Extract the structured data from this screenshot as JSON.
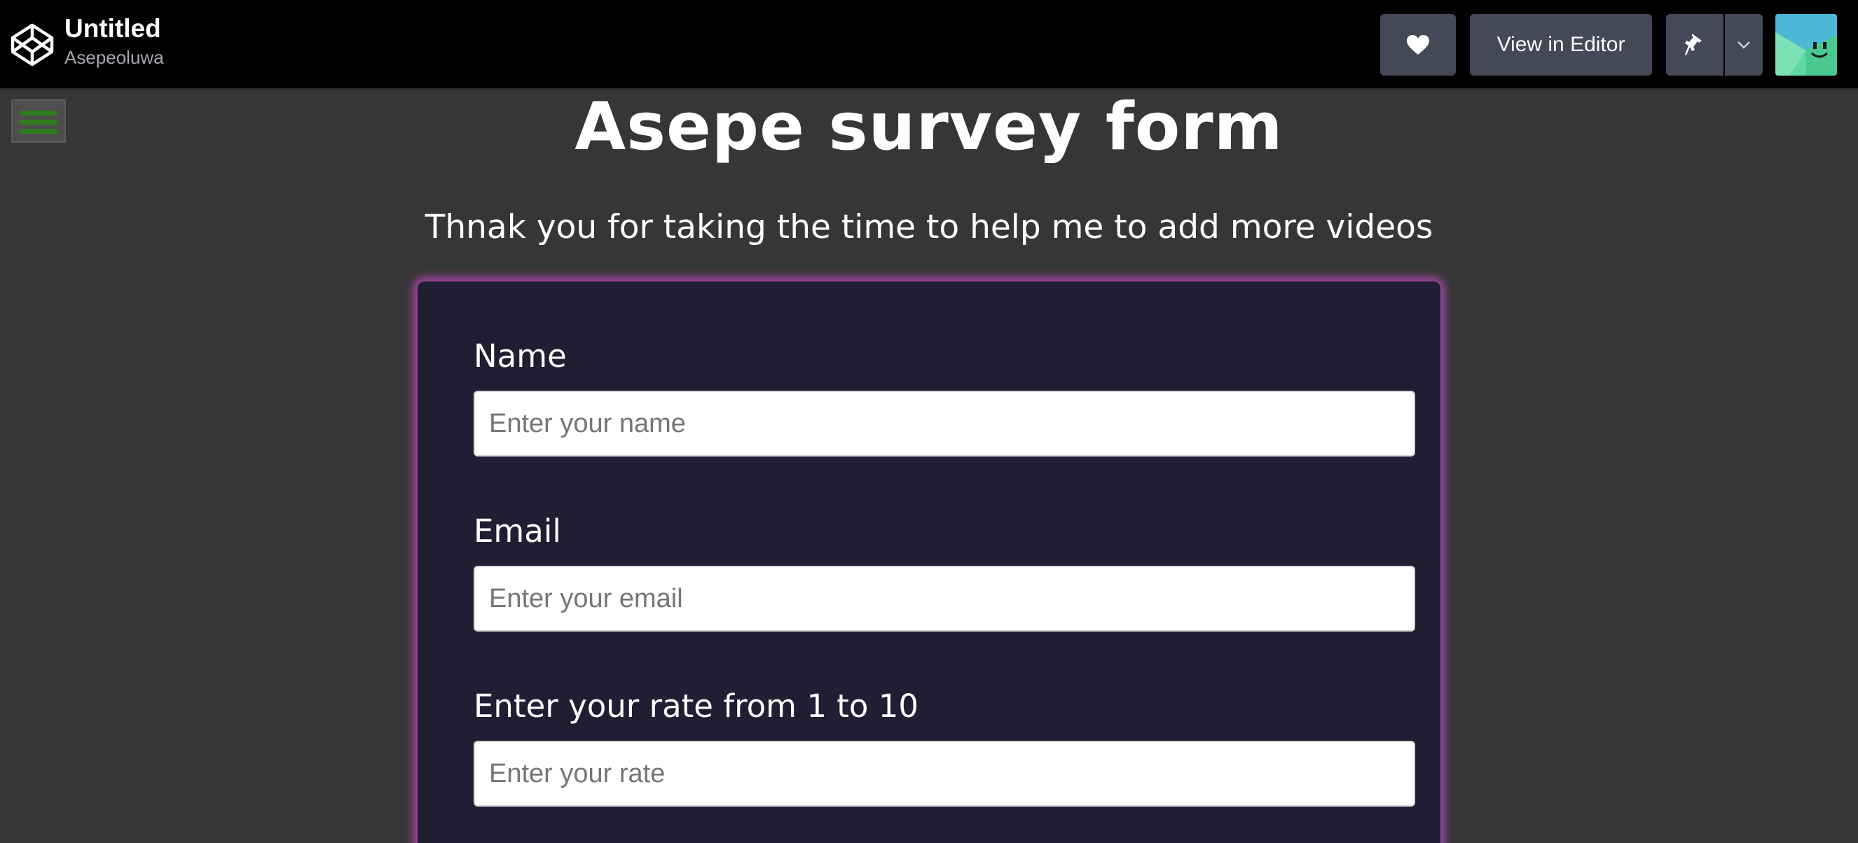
{
  "header": {
    "pen_title": "Untitled",
    "author": "Asepeoluwa",
    "view_in_editor_label": "View in Editor",
    "icons": {
      "logo": "codepen-logo-icon",
      "heart": "heart-icon",
      "pin": "pin-icon",
      "caret": "chevron-down-icon",
      "avatar": "user-avatar"
    }
  },
  "page": {
    "title": "Asepe survey form",
    "description": "Thnak you for taking the time to help me to add more videos"
  },
  "form": {
    "name_label": "Name",
    "name_placeholder": "Enter your name",
    "email_label": "Email",
    "email_placeholder": "Enter your email",
    "rate_label": "Enter your rate from 1 to 10",
    "rate_placeholder": "Enter your rate"
  },
  "colors": {
    "topbar_bg": "#000000",
    "page_bg": "#363636",
    "card_bg": "#1f1e33",
    "card_glow": "#b44bb4",
    "button_bg": "#444857",
    "hamburger_lines": "#2e7d1c"
  }
}
